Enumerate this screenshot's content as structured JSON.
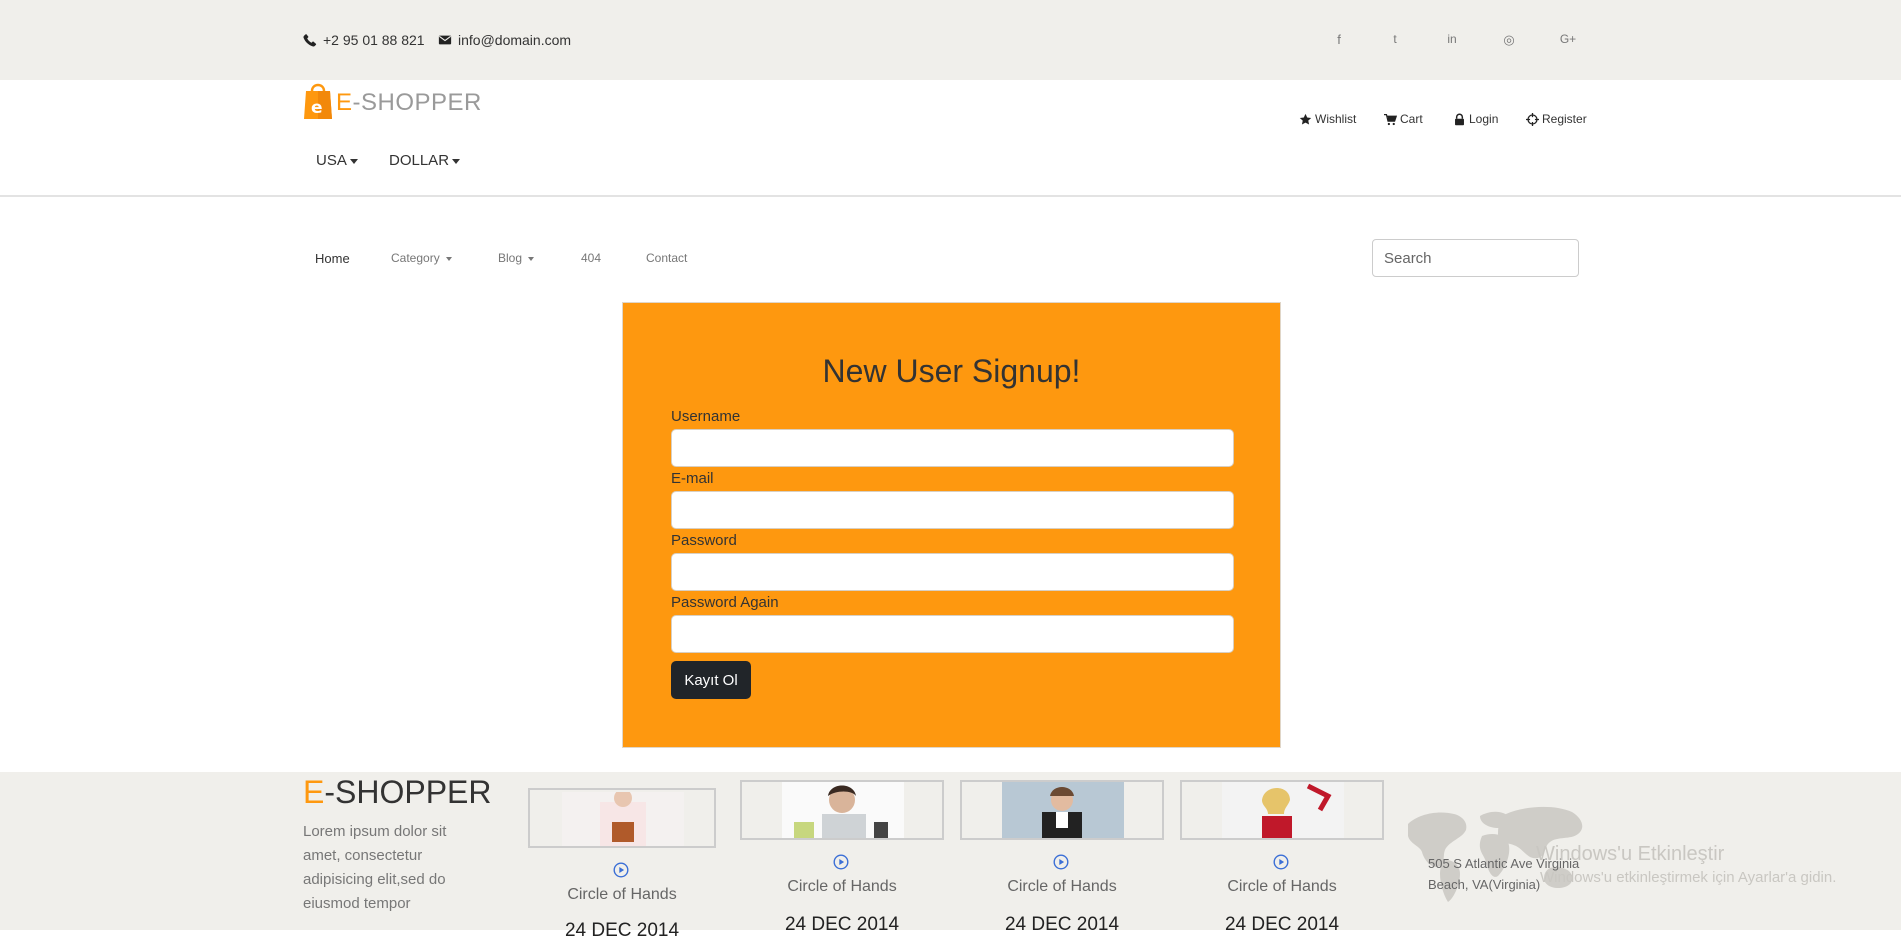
{
  "topbar": {
    "phone": "+2 95 01 88 821",
    "email": "info@domain.com",
    "social": [
      {
        "name": "facebook-icon",
        "glyph": "f"
      },
      {
        "name": "twitter-icon",
        "glyph": "t"
      },
      {
        "name": "linkedin-icon",
        "glyph": "in"
      },
      {
        "name": "dribbble-icon",
        "glyph": "◎"
      },
      {
        "name": "google-plus-icon",
        "glyph": "G+"
      }
    ]
  },
  "header": {
    "logo_e": "E",
    "logo_rest": "-SHOPPER",
    "country": "USA",
    "currency": "DOLLAR",
    "menu": {
      "wishlist": "Wishlist",
      "cart": "Cart",
      "login": "Login",
      "register": "Register"
    }
  },
  "nav": {
    "home": "Home",
    "category": "Category",
    "blog": "Blog",
    "notfound": "404",
    "contact": "Contact",
    "search_placeholder": "Search"
  },
  "signup": {
    "title": "New User Signup!",
    "username_label": "Username",
    "email_label": "E-mail",
    "password_label": "Password",
    "password_again_label": "Password Again",
    "submit": "Kayıt Ol"
  },
  "footer": {
    "brand_e": "E",
    "brand_rest": "-SHOPPER",
    "text": "Lorem ipsum dolor sit amet, consectetur adipisicing elit,sed do eiusmod tempor",
    "videos": [
      {
        "title": "Circle of Hands",
        "date": "24 DEC 2014"
      },
      {
        "title": "Circle of Hands",
        "date": "24 DEC 2014"
      },
      {
        "title": "Circle of Hands",
        "date": "24 DEC 2014"
      },
      {
        "title": "Circle of Hands",
        "date": "24 DEC 2014"
      }
    ],
    "address": "505 S Atlantic Ave Virginia Beach, VA(Virginia)"
  },
  "watermark": {
    "line1": "Windows'u Etkinleştir",
    "line2": "Windows'u etkinleştirmek için Ayarlar'a gidin."
  },
  "colors": {
    "accent": "#FE980F",
    "topbar": "#F0EFEB",
    "button": "#212529"
  }
}
